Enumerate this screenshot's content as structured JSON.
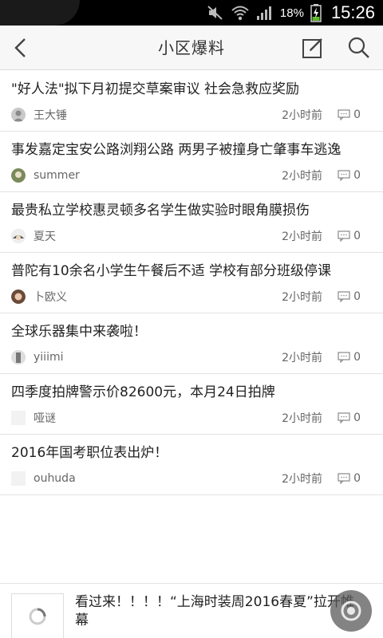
{
  "status_bar": {
    "battery_percent": "18%",
    "time": "15:26",
    "icons": [
      "mute-icon",
      "wifi-icon",
      "signal-icon",
      "battery-charging-icon"
    ]
  },
  "app_bar": {
    "title": "小区爆料",
    "icons": [
      "back-arrow-icon",
      "edit-icon",
      "search-icon"
    ]
  },
  "posts": [
    {
      "headline": "\"好人法\"拟下月初提交草案审议 社会急救应奖励",
      "author": "王大锤",
      "time": "2小时前",
      "comments": "0"
    },
    {
      "headline": "事发嘉定宝安公路浏翔公路 两男子被撞身亡肇事车逃逸",
      "author": "summer",
      "time": "2小时前",
      "comments": "0"
    },
    {
      "headline": "最贵私立学校惠灵顿多名学生做实验时眼角膜损伤",
      "author": "夏天",
      "time": "2小时前",
      "comments": "0"
    },
    {
      "headline": "普陀有10余名小学生午餐后不适 学校有部分班级停课",
      "author": "卜欧义",
      "time": "2小时前",
      "comments": "0"
    },
    {
      "headline": "全球乐器集中来袭啦！",
      "author": "yiiimi",
      "time": "2小时前",
      "comments": "0"
    },
    {
      "headline": "四季度拍牌警示价82600元，本月24日拍牌",
      "author": "哑谜",
      "time": "2小时前",
      "comments": "0"
    },
    {
      "headline": "2016年国考职位表出炉！",
      "author": "ouhuda",
      "time": "2小时前",
      "comments": "0"
    }
  ],
  "featured": {
    "headline": "看过来！！！！“上海时装周2016春夏”拉开帷幕"
  },
  "colors": {
    "status_bar": "#000000",
    "app_bar": "#f7f7f7",
    "divider": "#e2e2e2",
    "text": "#222222",
    "meta_text": "#666666"
  }
}
